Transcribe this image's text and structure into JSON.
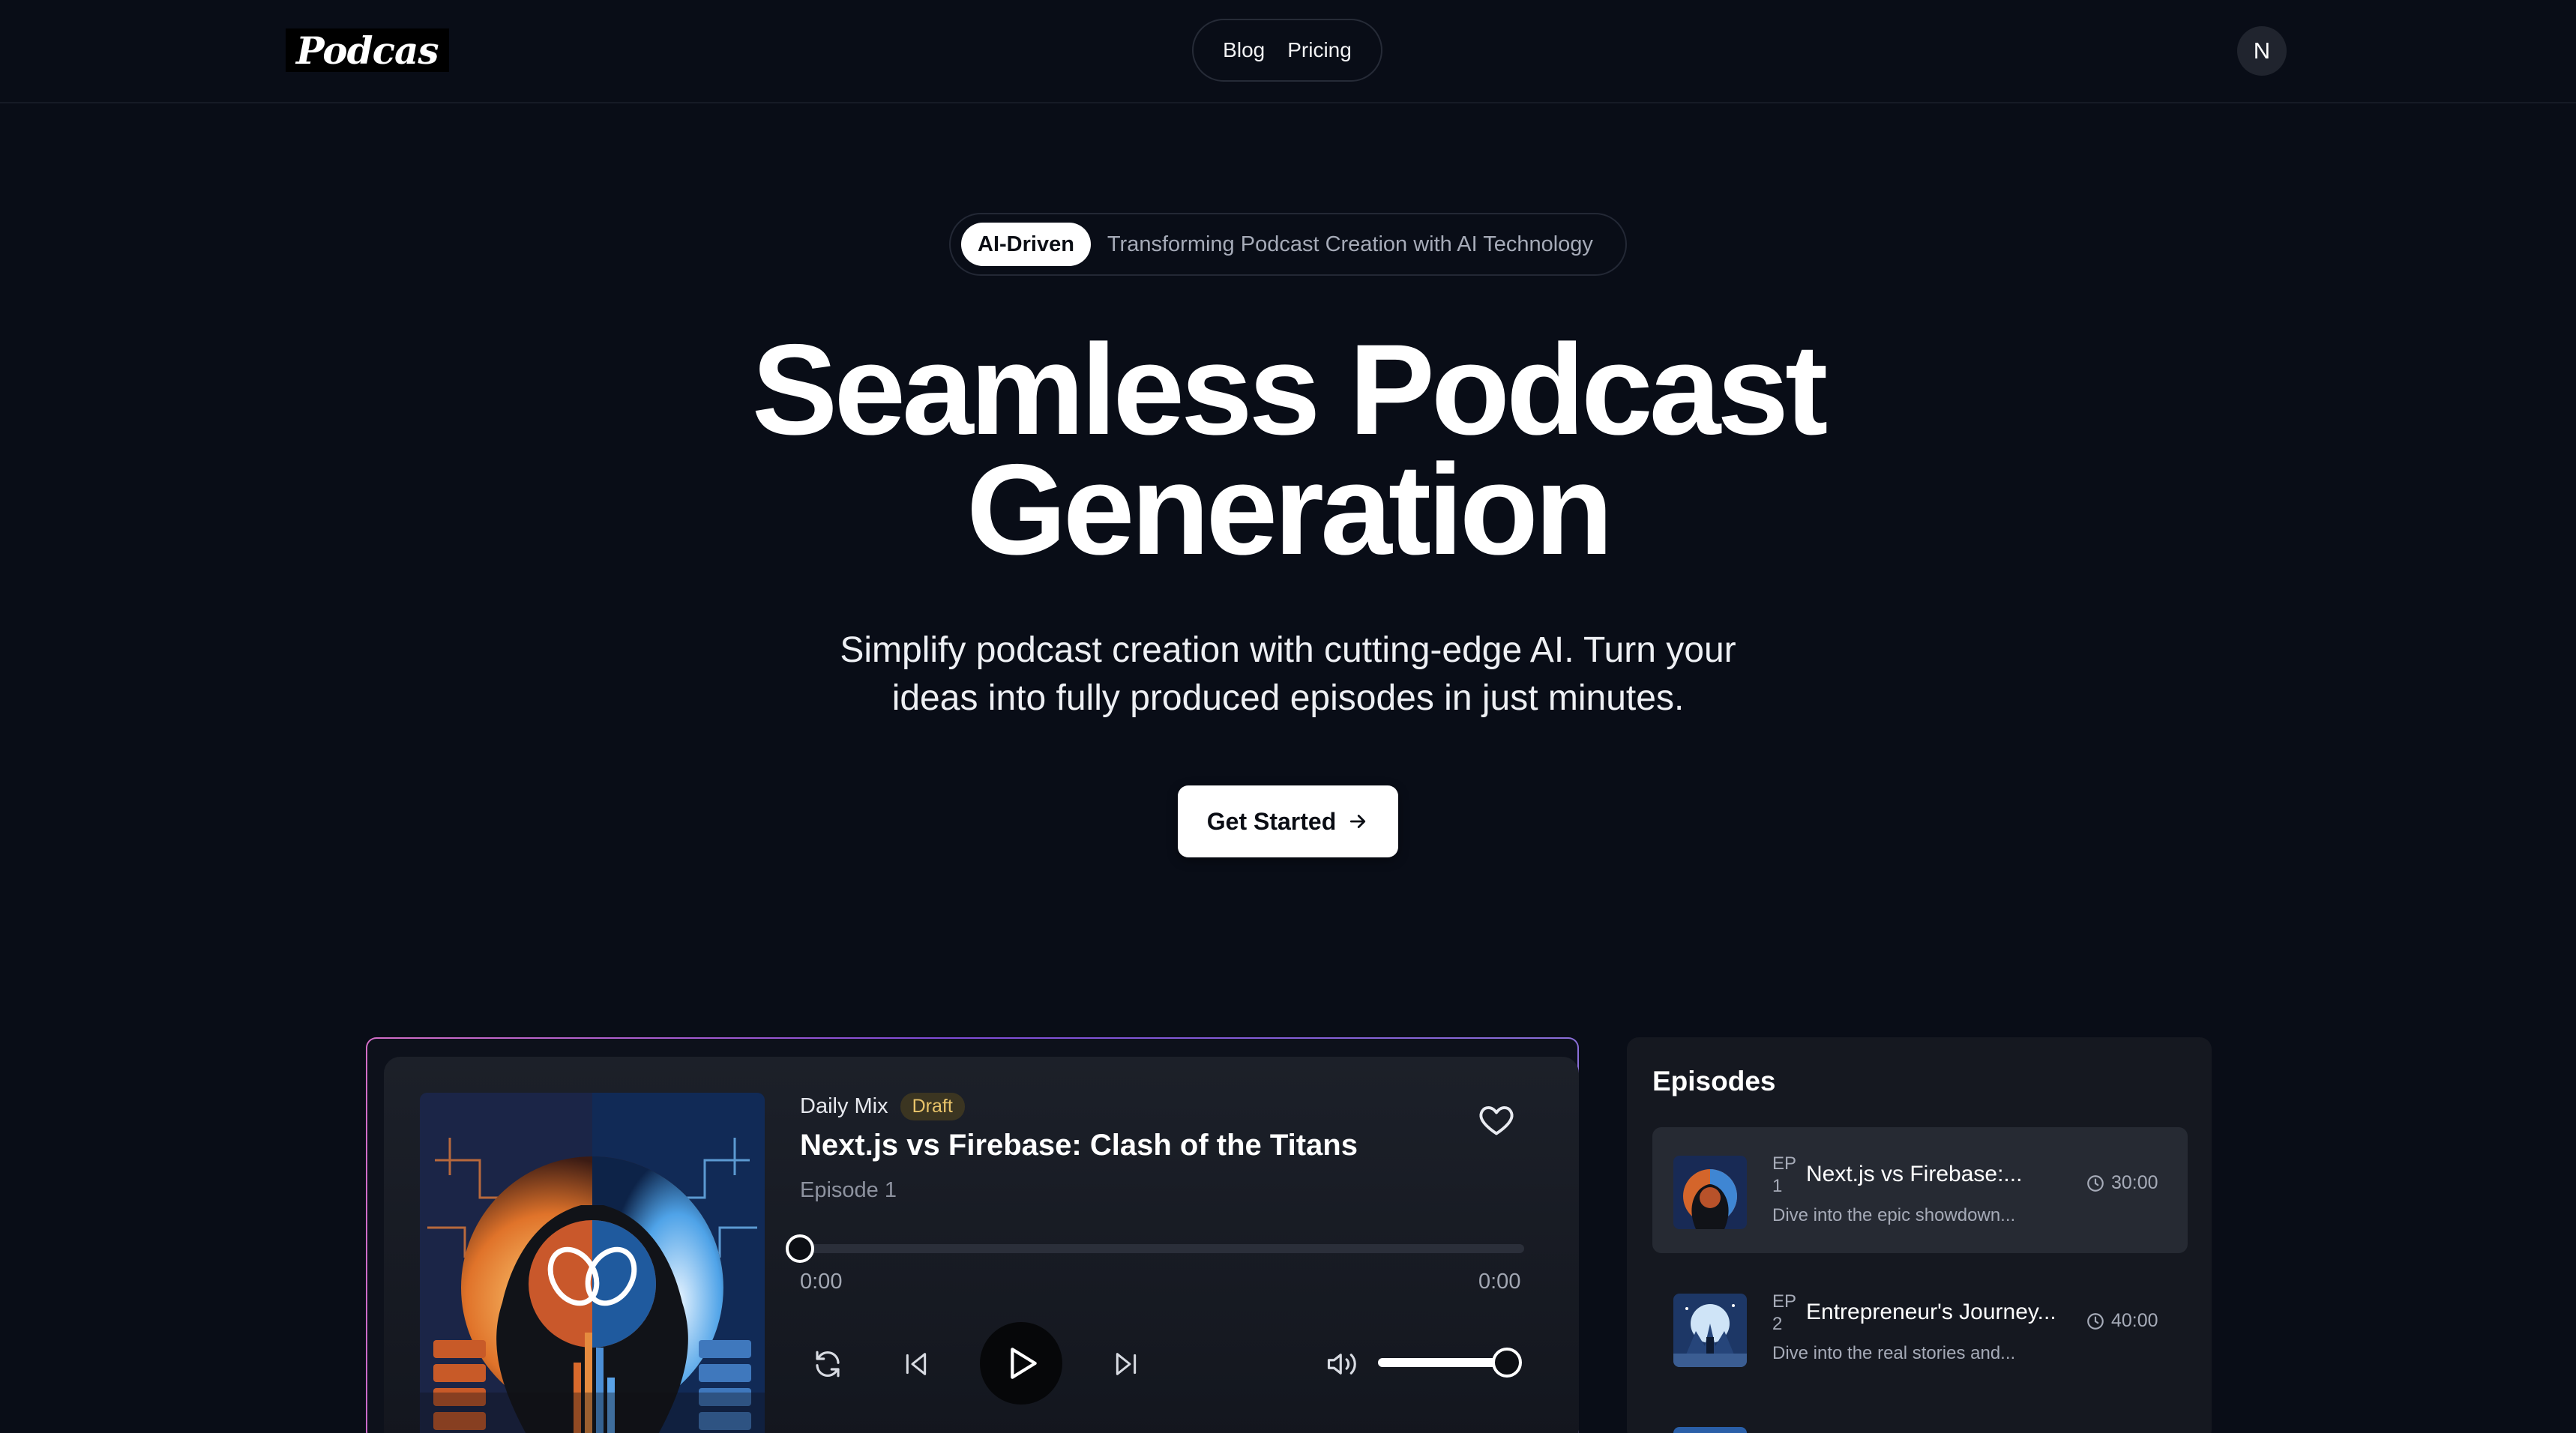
{
  "header": {
    "logo_text": "Podcas",
    "nav": [
      "Blog",
      "Pricing"
    ],
    "avatar_initial": "N"
  },
  "hero": {
    "badge_chip": "AI-Driven",
    "badge_text": "Transforming Podcast Creation with AI Technology",
    "title_line1": "Seamless Podcast",
    "title_line2": "Generation",
    "subtitle_line1": "Simplify podcast creation with cutting-edge AI. Turn your",
    "subtitle_line2": "ideas into fully produced episodes in just minutes.",
    "cta_label": "Get Started"
  },
  "player": {
    "collection": "Daily Mix",
    "status": "Draft",
    "title": "Next.js vs Firebase: Clash of the Titans",
    "episode": "Episode 1",
    "time_elapsed": "0:00",
    "time_total": "0:00",
    "progress_fraction": 0,
    "volume_fraction": 1
  },
  "episodes": {
    "heading": "Episodes",
    "items": [
      {
        "tag_line1": "EP",
        "tag_line2": "1",
        "title": "Next.js vs Firebase:...",
        "description": "Dive into the epic showdown...",
        "duration": "30:00"
      },
      {
        "tag_line1": "EP",
        "tag_line2": "2",
        "title": "Entrepreneur's Journey...",
        "description": "Dive into the real stories and...",
        "duration": "40:00"
      }
    ]
  },
  "colors": {
    "background": "#090d17",
    "draft_badge_text": "#e9c46a",
    "card_border_gradient_start": "#d46ec7",
    "card_border_gradient_end": "#8b72d8"
  },
  "icons": [
    "heart-icon",
    "repeat-icon",
    "skip-back-icon",
    "play-icon",
    "skip-forward-icon",
    "volume-icon",
    "clock-icon",
    "arrow-right-icon"
  ]
}
